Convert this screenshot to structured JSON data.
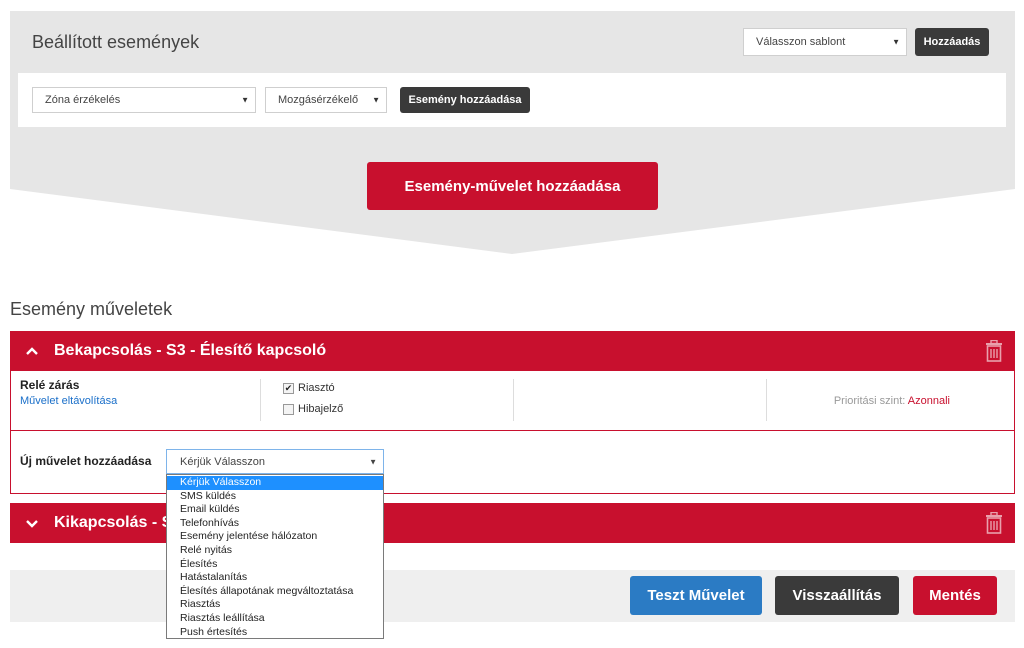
{
  "configured_events": {
    "title": "Beállított események",
    "template_select": "Válasszon sablont",
    "add_button": "Hozzáadás",
    "zone_select": "Zóna érzékelés",
    "sensor_select": "Mozgásérzékelő",
    "add_event_button": "Esemény hozzáadása",
    "add_event_action_button": "Esemény-művelet hozzáadása"
  },
  "event_actions": {
    "title": "Esemény műveletek",
    "panels": [
      {
        "heading": "Bekapcsolás - S3 - Élesítő kapcsoló",
        "expanded": true,
        "action_title": "Relé zárás",
        "remove_link": "Művelet eltávolítása",
        "checkboxes": [
          {
            "label": "Riasztó",
            "checked": true
          },
          {
            "label": "Hibajelző",
            "checked": false
          }
        ],
        "priority_label": "Prioritási szint:",
        "priority_value": "Azonnali",
        "new_action_label": "Új művelet hozzáadása",
        "new_action_select": "Kérjük Válasszon",
        "dropdown_options": [
          "Kérjük Válasszon",
          "SMS küldés",
          "Email küldés",
          "Telefonhívás",
          "Esemény jelentése hálózaton",
          "Relé nyitás",
          "Élesítés",
          "Hatástalanítás",
          "Élesítés állapotának megváltoztatása",
          "Riasztás",
          "Riasztás leállítása",
          "Push értesítés"
        ],
        "dropdown_selected_index": 0
      },
      {
        "heading": "Kikapcsolás - S",
        "expanded": false
      }
    ]
  },
  "footer": {
    "test_button": "Teszt Művelet",
    "reset_button": "Visszaállítás",
    "save_button": "Mentés"
  },
  "colors": {
    "accent_red": "#c8102e",
    "dark_button": "#3a3a3a",
    "blue_button": "#2b7bc4",
    "panel_grey": "#e6e6e6",
    "link_blue": "#1a6fc9",
    "option_highlight": "#1e90ff"
  }
}
